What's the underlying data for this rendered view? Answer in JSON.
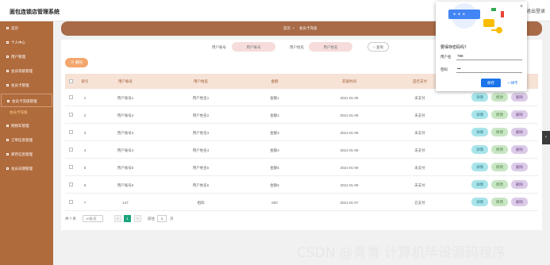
{
  "app": {
    "title": "面包连锁店管理系统",
    "topbar_right": "退出登录"
  },
  "sidebar": {
    "items": [
      {
        "label": "首页"
      },
      {
        "label": "个人中心"
      },
      {
        "label": "用户管理"
      },
      {
        "label": "会员等级管理"
      },
      {
        "label": "会员卡管理"
      },
      {
        "label": "会员卡充值管理"
      },
      {
        "label": "购物车管理"
      },
      {
        "label": "订单信息管理"
      },
      {
        "label": "库存信息管理"
      },
      {
        "label": "会员日期管理"
      }
    ],
    "sub_item": "会员卡充值"
  },
  "breadcrumb": {
    "home": "首页",
    "current": "会员卡充值"
  },
  "search": {
    "account_label": "用户账号",
    "account_placeholder": "用户账号",
    "name_label": "用户姓名",
    "name_placeholder": "用户姓名",
    "button": "查询"
  },
  "toolbar": {
    "delete_label": "删除"
  },
  "table": {
    "headers": [
      "索引",
      "用户账号",
      "用户姓名",
      "金额",
      "充值时间",
      "是否支付"
    ],
    "rows": [
      {
        "index": "1",
        "account": "用户账号1",
        "name": "用户姓名1",
        "amount": "金额1",
        "date": "2021-01-09",
        "paid": "未支付"
      },
      {
        "index": "2",
        "account": "用户账号2",
        "name": "用户姓名2",
        "amount": "金额2",
        "date": "2021-01-09",
        "paid": "未支付"
      },
      {
        "index": "3",
        "account": "用户账号3",
        "name": "用户姓名3",
        "amount": "金额3",
        "date": "2021-01-09",
        "paid": "未支付"
      },
      {
        "index": "4",
        "account": "用户账号4",
        "name": "用户姓名4",
        "amount": "金额4",
        "date": "2021-01-09",
        "paid": "未支付"
      },
      {
        "index": "5",
        "account": "用户账号5",
        "name": "用户姓名5",
        "amount": "金额5",
        "date": "2021-01-09",
        "paid": "未支付"
      },
      {
        "index": "6",
        "account": "用户账号6",
        "name": "用户姓名6",
        "amount": "金额6",
        "date": "2021-01-09",
        "paid": "未支付"
      },
      {
        "index": "7",
        "account": "147",
        "name": "祖四",
        "amount": "600",
        "date": "2021-01-07",
        "paid": "已支付"
      }
    ],
    "actions": {
      "detail": "详情",
      "edit": "修改",
      "delete": "删除"
    }
  },
  "pager": {
    "total": "共 7 条",
    "page_size": "10条/页",
    "prev": "<",
    "current": "1",
    "next": ">",
    "goto_label": "前往",
    "goto_value": "1",
    "page_unit": "页"
  },
  "password_popup": {
    "title": "要保存密码吗？",
    "username_label": "用户名",
    "username_value": "789",
    "password_label": "密码",
    "password_value": "•••",
    "save": "保存",
    "never": "一律不",
    "close": "×"
  },
  "side_tab": "‹",
  "watermark": "CSDN @青青  计算机毕设源码程序",
  "colors": {
    "sidebar": "#b06b3d",
    "accent": "#1aa37e",
    "delete": "#f3a76e"
  }
}
